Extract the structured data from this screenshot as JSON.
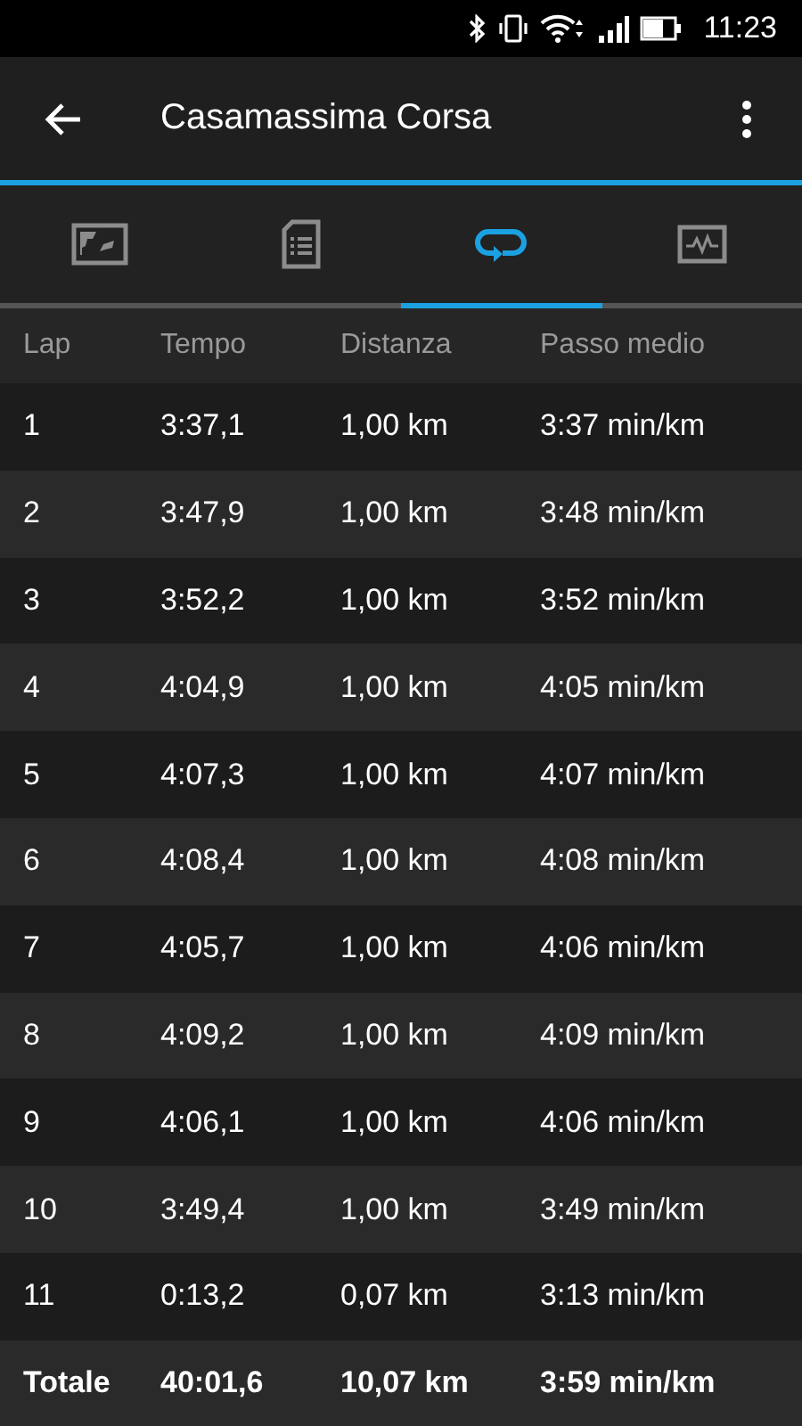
{
  "status_bar": {
    "time": "11:23"
  },
  "app_bar": {
    "title": "Casamassima Corsa"
  },
  "tabs": [
    {
      "kind": "map",
      "selected": false
    },
    {
      "kind": "details",
      "selected": false
    },
    {
      "kind": "laps",
      "selected": true
    },
    {
      "kind": "chart",
      "selected": false
    }
  ],
  "table": {
    "columns": [
      "Lap",
      "Tempo",
      "Distanza",
      "Passo medio"
    ],
    "rows": [
      [
        "1",
        "3:37,1",
        "1,00 km",
        "3:37 min/km"
      ],
      [
        "2",
        "3:47,9",
        "1,00 km",
        "3:48 min/km"
      ],
      [
        "3",
        "3:52,2",
        "1,00 km",
        "3:52 min/km"
      ],
      [
        "4",
        "4:04,9",
        "1,00 km",
        "4:05 min/km"
      ],
      [
        "5",
        "4:07,3",
        "1,00 km",
        "4:07 min/km"
      ],
      [
        "6",
        "4:08,4",
        "1,00 km",
        "4:08 min/km"
      ],
      [
        "7",
        "4:05,7",
        "1,00 km",
        "4:06 min/km"
      ],
      [
        "8",
        "4:09,2",
        "1,00 km",
        "4:09 min/km"
      ],
      [
        "9",
        "4:06,1",
        "1,00 km",
        "4:06 min/km"
      ],
      [
        "10",
        "3:49,4",
        "1,00 km",
        "3:49 min/km"
      ],
      [
        "11",
        "0:13,2",
        "0,07 km",
        "3:13 min/km"
      ]
    ],
    "total": [
      "Totale",
      "40:01,6",
      "10,07 km",
      "3:59 min/km"
    ]
  }
}
